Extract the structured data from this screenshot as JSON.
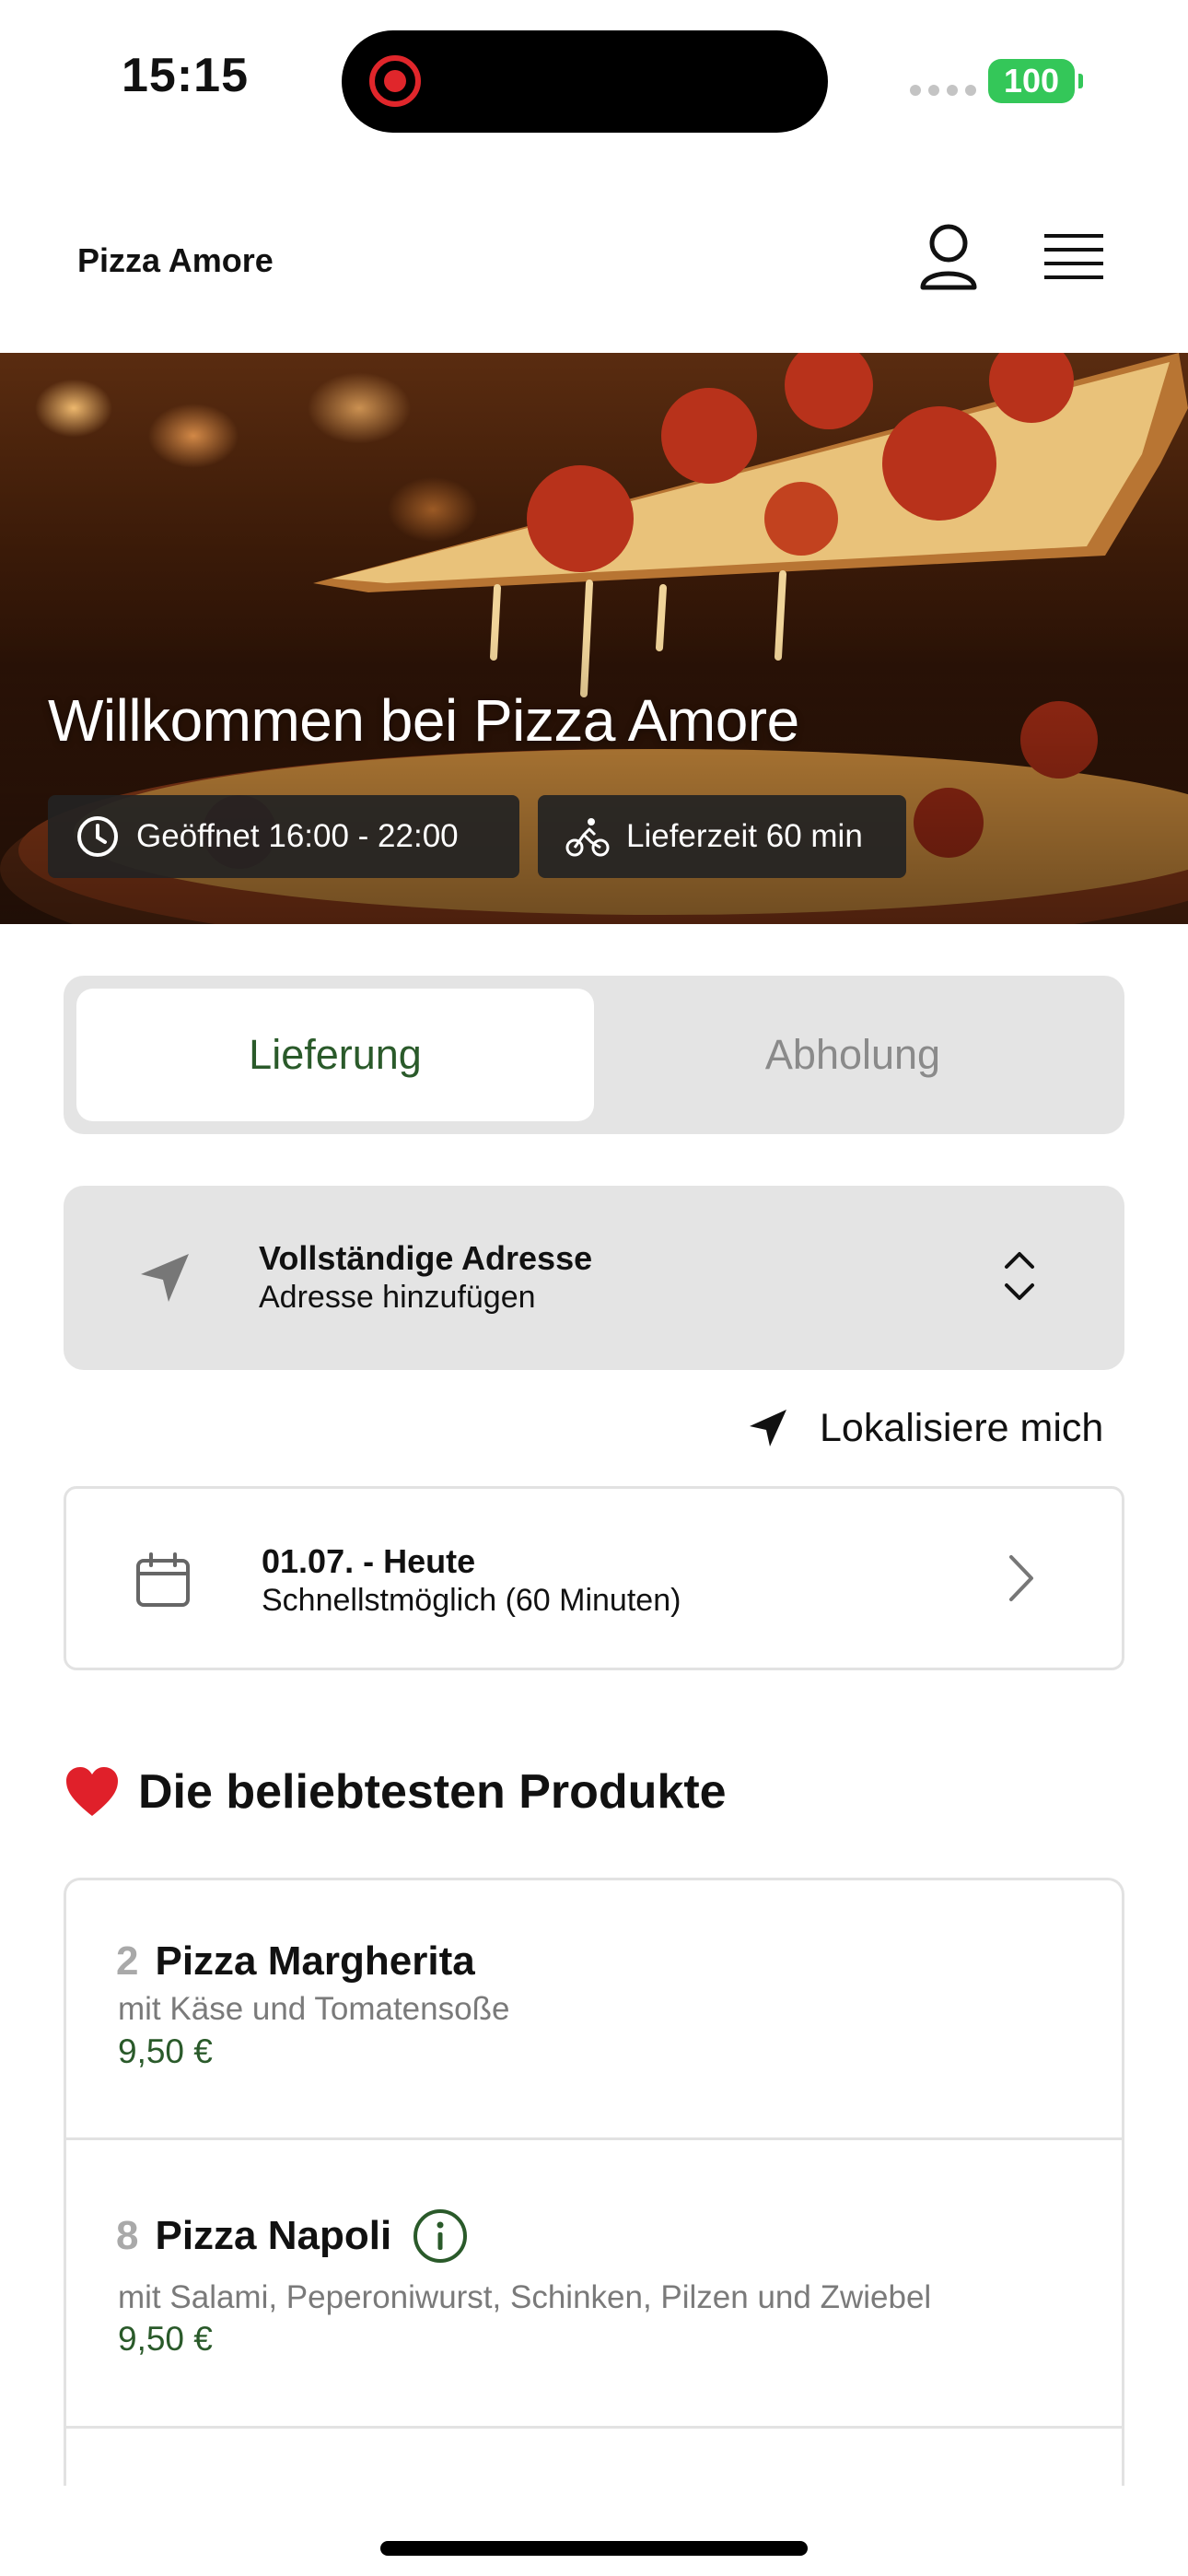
{
  "status_bar": {
    "time": "15:15",
    "battery": "100"
  },
  "header": {
    "brand": "Pizza Amore"
  },
  "hero": {
    "title": "Willkommen bei Pizza Amore",
    "hours": "Geöffnet 16:00 - 22:00",
    "delivery_time": "Lieferzeit 60 min"
  },
  "mode_toggle": {
    "delivery": "Lieferung",
    "pickup": "Abholung",
    "selected": "Lieferung"
  },
  "address": {
    "title": "Vollständige Adresse",
    "subtitle": "Adresse hinzufügen"
  },
  "locate": {
    "label": "Lokalisiere mich"
  },
  "date": {
    "title": "01.07. - Heute",
    "subtitle": "Schnellstmöglich (60 Minuten)"
  },
  "products_section": {
    "title": "Die beliebtesten Produkte"
  },
  "products": [
    {
      "number": "2",
      "name": "Pizza Margherita",
      "description": "mit Käse und Tomatensoße",
      "price": "9,50 €"
    },
    {
      "number": "8",
      "name": "Pizza Napoli",
      "description": "mit Salami, Peperoniwurst, Schinken, Pilzen und Zwiebel",
      "price": "9,50 €"
    }
  ],
  "colors": {
    "accent_green": "#2a5a2a",
    "card_gray": "#e4e4e4",
    "battery_green": "#34c759",
    "recording_red": "#e0262b"
  }
}
